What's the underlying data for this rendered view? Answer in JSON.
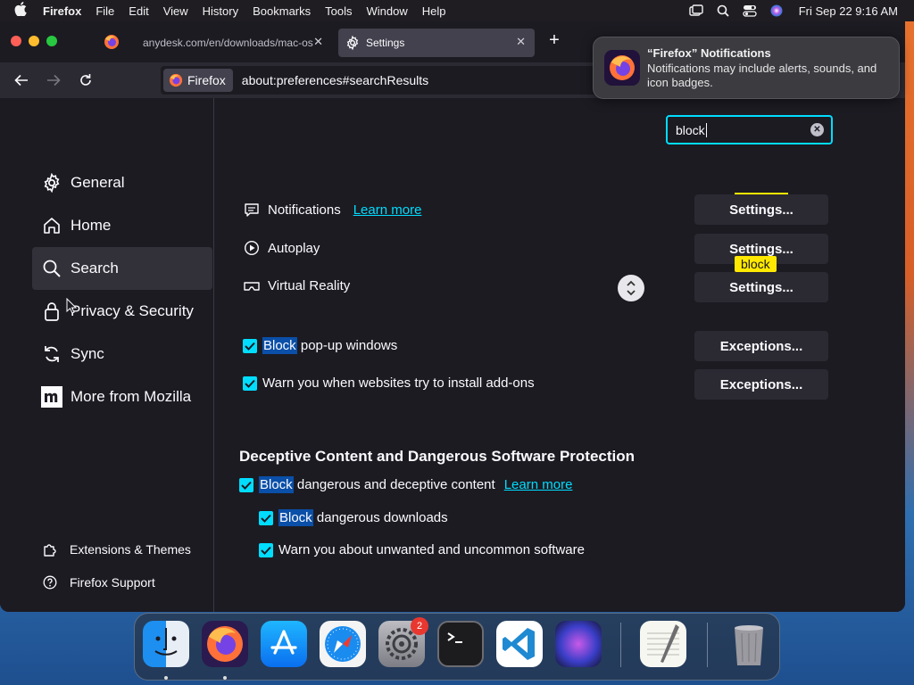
{
  "menubar": {
    "app": "Firefox",
    "items": [
      "File",
      "Edit",
      "View",
      "History",
      "Bookmarks",
      "Tools",
      "Window",
      "Help"
    ],
    "clock": "Fri Sep 22  9:16 AM"
  },
  "tabs": [
    {
      "label": "anydesk.com/en/downloads/mac-os"
    },
    {
      "label": "Settings"
    }
  ],
  "urlbar": {
    "identity": "Firefox",
    "url": "about:preferences#searchResults"
  },
  "notification": {
    "title": "“Firefox” Notifications",
    "body": "Notifications may include alerts, sounds, and icon badges."
  },
  "sidebar": {
    "categories": [
      "General",
      "Home",
      "Search",
      "Privacy & Security",
      "Sync",
      "More from Mozilla"
    ],
    "selected": "Search",
    "footer": [
      "Extensions & Themes",
      "Firefox Support"
    ]
  },
  "search": {
    "value": "block"
  },
  "permissions": {
    "notifications": "Notifications",
    "learn_more": "Learn more",
    "autoplay": "Autoplay",
    "vr": "Virtual Reality",
    "settings_btn": "Settings...",
    "tooltip": "block"
  },
  "checks": {
    "popup_hl": "Block",
    "popup_rest": " pop-up windows",
    "addons": "Warn you when websites try to install add-ons",
    "exceptions_btn": "Exceptions..."
  },
  "deceptive": {
    "heading": "Deceptive Content and Dangerous Software Protection",
    "block_hl": "Block",
    "dangerous_rest": " dangerous and deceptive content",
    "learn_more": "Learn more",
    "downloads_rest": " dangerous downloads",
    "unwanted": "Warn you about unwanted and uncommon software"
  },
  "dock": {
    "settings_badge": "2"
  },
  "colors": {
    "accent": "#00ddff",
    "highlight": "#0a4fa8",
    "tooltip": "#ffe900",
    "bg": "#1c1b22"
  }
}
